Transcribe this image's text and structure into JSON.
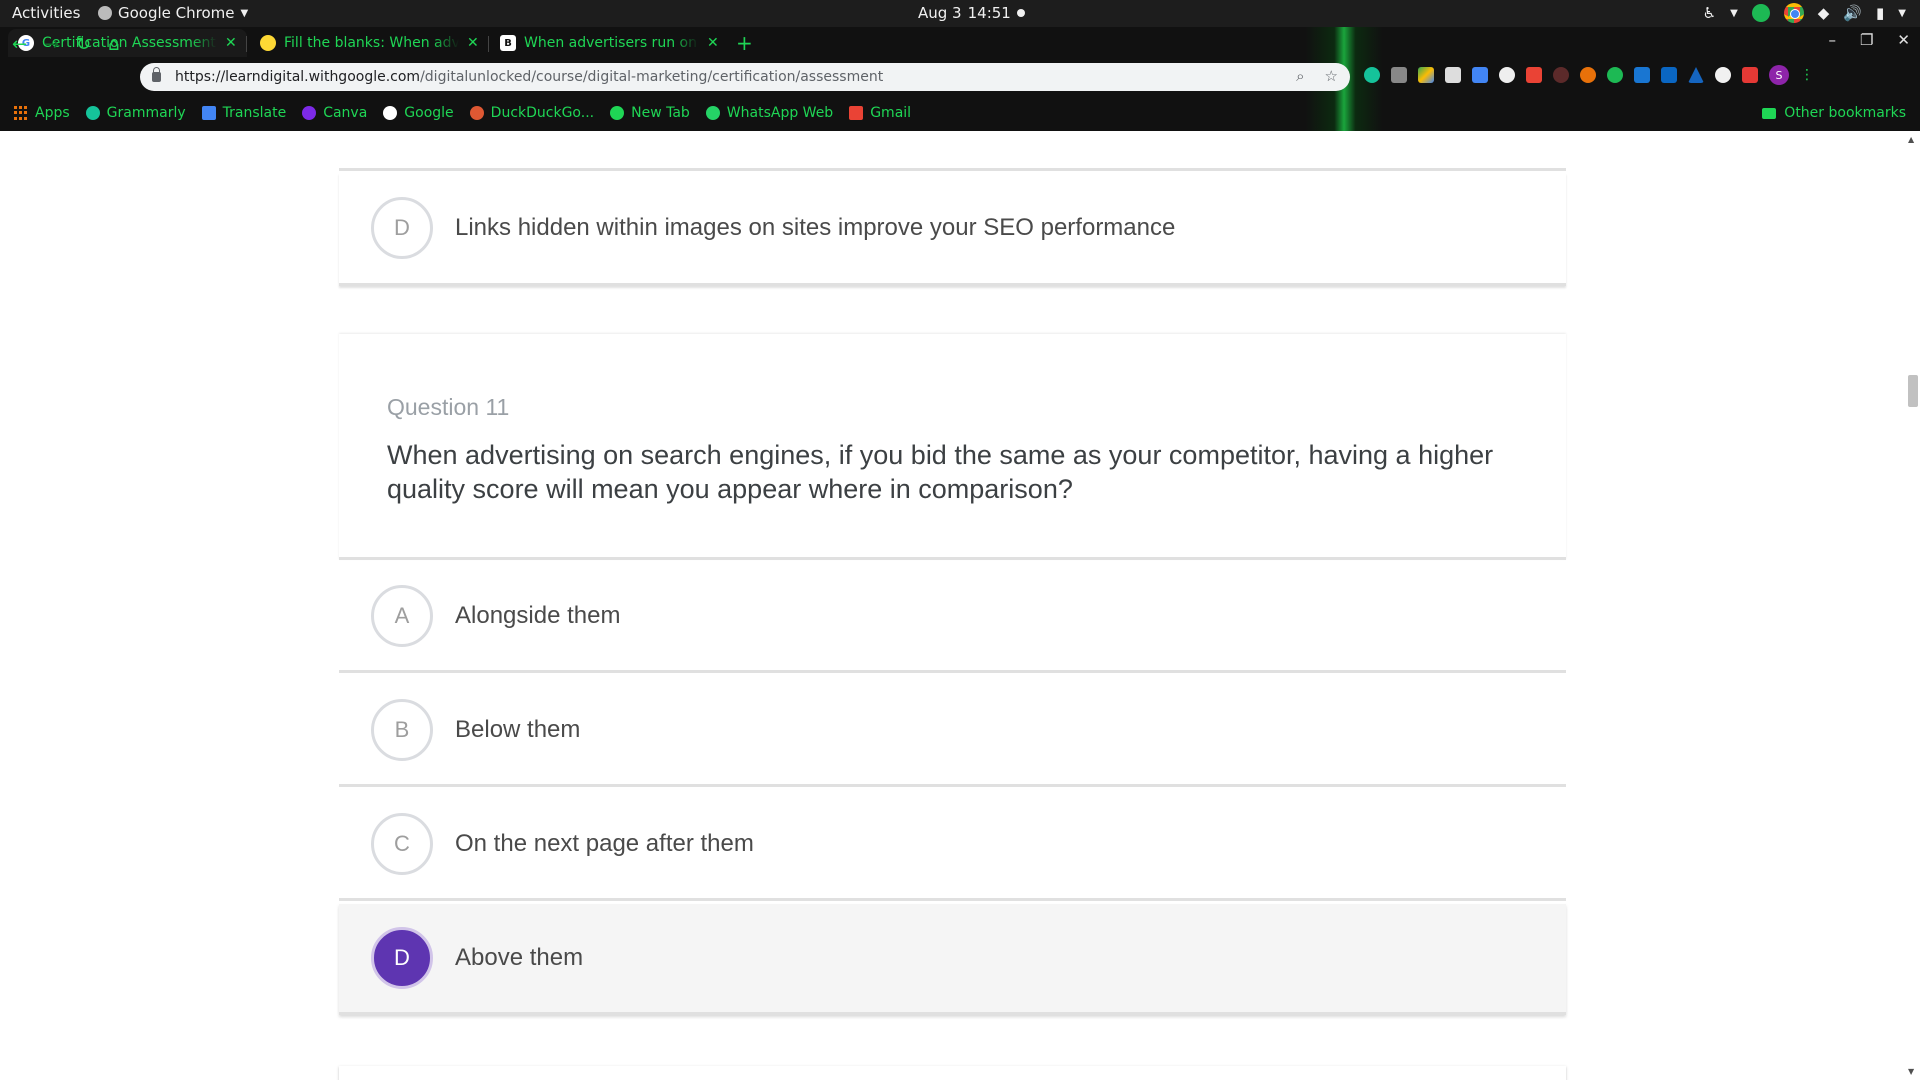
{
  "system": {
    "activities": "Activities",
    "app_name": "Google Chrome",
    "date": "Aug 3",
    "time": "14:51"
  },
  "browser": {
    "tabs": [
      {
        "title": "Certification Assessment",
        "active": true
      },
      {
        "title": "Fill the blanks: When adve",
        "active": false
      },
      {
        "title": "When advertisers run onl",
        "active": false
      }
    ],
    "url_host": "https://learndigital.withgoogle.com",
    "url_path": "/digitalunlocked/course/digital-marketing/certification/assessment",
    "bookmarks": [
      "Apps",
      "Grammarly",
      "Translate",
      "Canva",
      "Google",
      "DuckDuckGo...",
      "New Tab",
      "WhatsApp Web",
      "Gmail"
    ],
    "other_bookmarks": "Other bookmarks",
    "profile_initial": "S"
  },
  "prev_question": {
    "option_d": {
      "letter": "D",
      "text": "Links hidden within images on sites improve your SEO performance"
    }
  },
  "question": {
    "label": "Question 11",
    "text": "When advertising on search engines, if you bid the same as your competitor, having a higher quality score will mean you appear where in comparison?",
    "options": [
      {
        "letter": "A",
        "text": "Alongside them",
        "selected": false
      },
      {
        "letter": "B",
        "text": "Below them",
        "selected": false
      },
      {
        "letter": "C",
        "text": "On the next page after them",
        "selected": false
      },
      {
        "letter": "D",
        "text": "Above them",
        "selected": true
      }
    ]
  },
  "colors": {
    "accent_selected": "#5e35b1",
    "browser_theme_text": "#1fd655"
  }
}
